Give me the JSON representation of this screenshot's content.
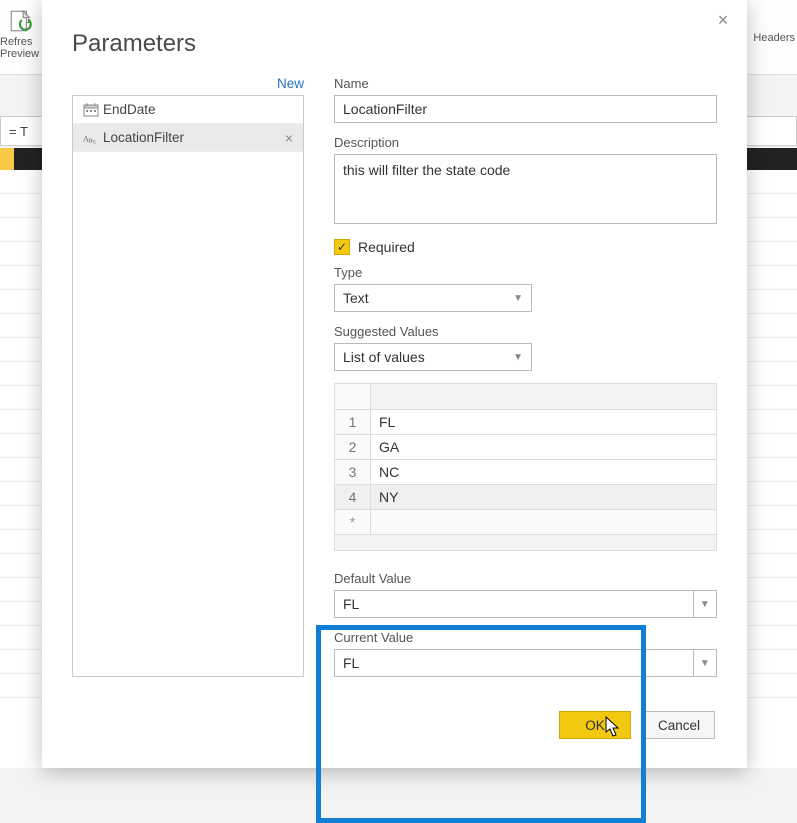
{
  "ribbon": {
    "refresh_line1": "Refres",
    "refresh_line2": "Preview",
    "headers_label": "Headers"
  },
  "formula_bar": "= T",
  "dialog": {
    "title": "Parameters",
    "new_label": "New",
    "close_glyph": "×"
  },
  "param_list": {
    "items": [
      {
        "label": "EndDate",
        "icon": "calendar"
      },
      {
        "label": "LocationFilter",
        "icon": "text"
      }
    ],
    "selected_index": 1
  },
  "form": {
    "name_label": "Name",
    "name_value": "LocationFilter",
    "description_label": "Description",
    "description_value": "this will filter the state code",
    "required_label": "Required",
    "required_checked": true,
    "type_label": "Type",
    "type_value": "Text",
    "suggested_label": "Suggested Values",
    "suggested_value": "List of values",
    "values_rows": [
      "FL",
      "GA",
      "NC",
      "NY"
    ],
    "addrow_label": "*",
    "default_label": "Default Value",
    "default_value": "FL",
    "current_label": "Current Value",
    "current_value": "FL"
  },
  "actions": {
    "ok": "OK",
    "cancel": "Cancel"
  }
}
